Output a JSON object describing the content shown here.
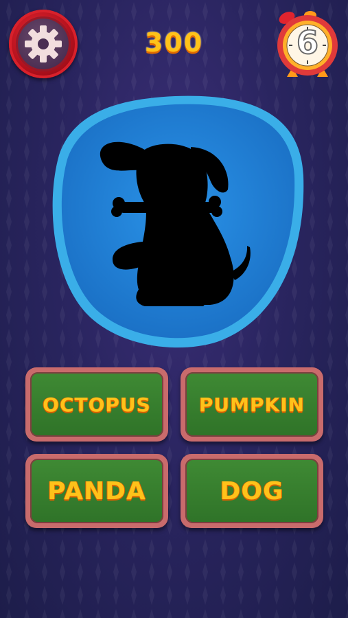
{
  "game": {
    "score": "300",
    "timer_seconds": "6",
    "silhouette": "dog-silhouette",
    "answers": [
      {
        "label": "OCTOPUS"
      },
      {
        "label": "PUMPKIN"
      },
      {
        "label": "PANDA"
      },
      {
        "label": "DOG"
      }
    ]
  },
  "icons": {
    "settings": "gear-icon",
    "timer": "alarm-clock-icon"
  },
  "colors": {
    "background": "#2a2560",
    "score": "#ffc21a",
    "plate": "#1f7fd6",
    "answer_face": "#3f8a34",
    "answer_border": "#c96b6c",
    "settings_ring": "#d8212b"
  }
}
